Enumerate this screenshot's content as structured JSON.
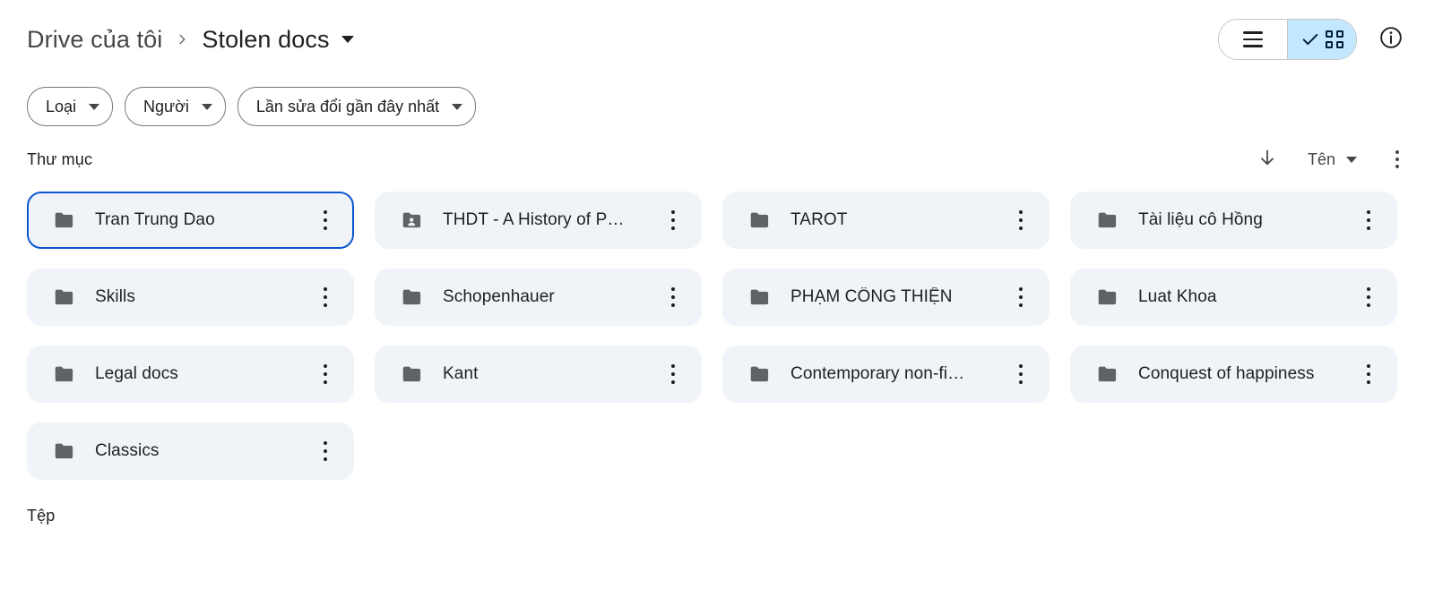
{
  "header": {
    "breadcrumb": {
      "root": "Drive của tôi",
      "separator": "›",
      "current": "Stolen docs"
    },
    "view_toggle": {
      "list_label": "list-view",
      "grid_label": "grid-view",
      "selected": "grid",
      "selected_bg": "#c2e7ff"
    },
    "info_label": "info"
  },
  "filters": [
    {
      "label": "Loại"
    },
    {
      "label": "Người"
    },
    {
      "label": "Lần sửa đổi gần đây nhất"
    }
  ],
  "folders_section": {
    "title": "Thư mục",
    "sort_direction": "descending-arrow",
    "sort_field": "Tên",
    "items": [
      {
        "name": "Tran Trung Dao",
        "shared": false,
        "selected": true
      },
      {
        "name": "THDT - A History of P…",
        "shared": true,
        "selected": false
      },
      {
        "name": "TAROT",
        "shared": false,
        "selected": false
      },
      {
        "name": "Tài liệu cô Hồng",
        "shared": false,
        "selected": false
      },
      {
        "name": "Skills",
        "shared": false,
        "selected": false
      },
      {
        "name": "Schopenhauer",
        "shared": false,
        "selected": false
      },
      {
        "name": "PHẠM CÔNG THIỆN",
        "shared": false,
        "selected": false
      },
      {
        "name": "Luat Khoa",
        "shared": false,
        "selected": false
      },
      {
        "name": "Legal docs",
        "shared": false,
        "selected": false
      },
      {
        "name": "Kant",
        "shared": false,
        "selected": false
      },
      {
        "name": "Contemporary non-fi…",
        "shared": false,
        "selected": false
      },
      {
        "name": "Conquest of happiness",
        "shared": false,
        "selected": false
      },
      {
        "name": "Classics",
        "shared": false,
        "selected": false
      }
    ]
  },
  "files_section": {
    "title": "Tệp"
  },
  "colors": {
    "card_bg": "#f0f4f9",
    "selected_border": "#0b57d0",
    "folder_icon": "#5f6368",
    "toggle_active": "#c2e7ff"
  }
}
